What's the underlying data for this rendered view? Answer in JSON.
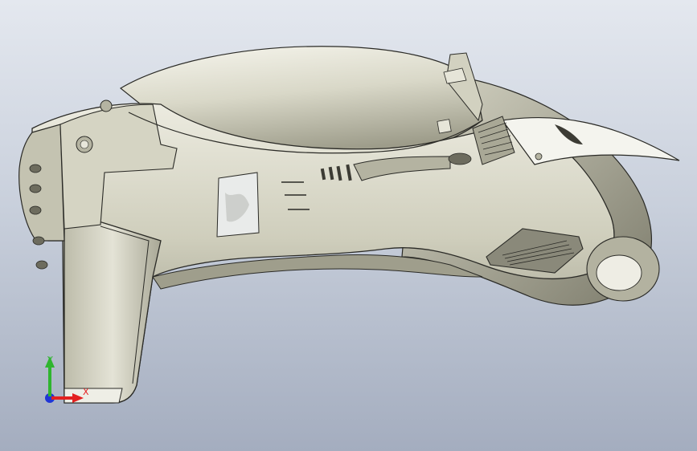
{
  "viewport": {
    "background_top": "#e4e8ef",
    "background_bottom": "#a4adbf"
  },
  "model": {
    "body_color": "#c8c7b4",
    "shadow_color": "#8f8e7d",
    "highlight_color": "#f1f0e6",
    "edge_color": "#2a2a26",
    "blade_color": "#f4f4ee"
  },
  "triad": {
    "x_label": "X",
    "y_label": "Y",
    "x_color": "#e32020",
    "y_color": "#2fb52f",
    "z_color": "#1f35d6"
  }
}
